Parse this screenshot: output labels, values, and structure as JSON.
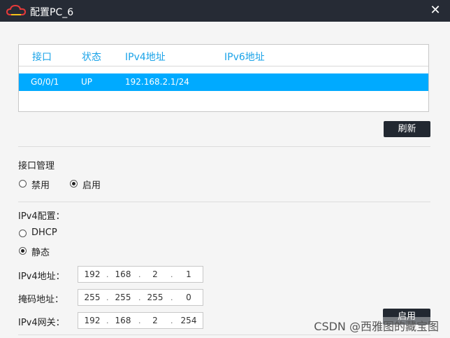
{
  "window": {
    "title": "配置PC_6",
    "close_glyph": "✕"
  },
  "interfaces_table": {
    "headers": [
      "接口",
      "状态",
      "IPv4地址",
      "IPv6地址"
    ],
    "rows": [
      {
        "interface": "G0/0/1",
        "status": "UP",
        "ipv4": "192.168.2.1/24",
        "ipv6": ""
      }
    ],
    "refresh_label": "刷新"
  },
  "interface_management": {
    "title": "接口管理",
    "options": [
      {
        "label": "禁用",
        "selected": false
      },
      {
        "label": "启用",
        "selected": true
      }
    ]
  },
  "ipv4_config": {
    "title": "IPv4配置：",
    "options": [
      {
        "label": "DHCP",
        "selected": false
      },
      {
        "label": "静态",
        "selected": true
      }
    ],
    "address_label": "IPv4地址：",
    "address": [
      "192",
      "168",
      "2",
      "1"
    ],
    "mask_label": "掩码地址：",
    "mask": [
      "255",
      "255",
      "255",
      "0"
    ],
    "gateway_label": "IPv4网关：",
    "gateway": [
      "192",
      "168",
      "2",
      "254"
    ],
    "apply_label": "启用"
  },
  "watermark": "CSDN @西雅图的藏宝图",
  "colors": {
    "titlebar": "#262b35",
    "selected_row": "#00aaff",
    "header_text": "#1aa3e8",
    "button": "#222831"
  }
}
